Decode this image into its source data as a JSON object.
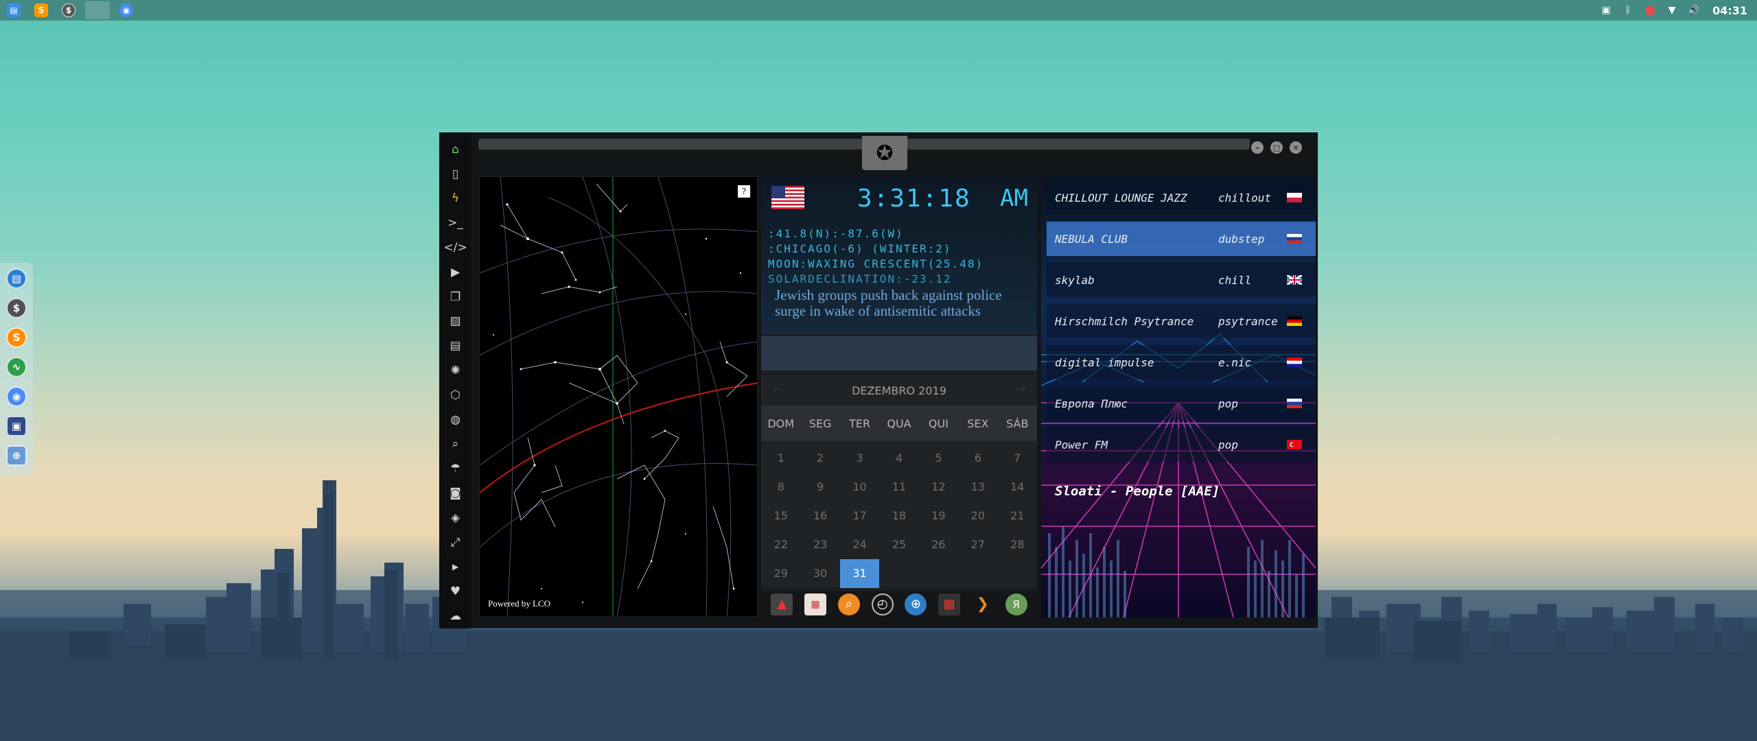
{
  "top_panel": {
    "launchers": [
      {
        "name": "files",
        "icon": "folder-icon",
        "color": "#3a8ee6"
      },
      {
        "name": "sublime",
        "icon": "sublime-icon",
        "color": "#ff9800"
      },
      {
        "name": "terminal-dollar",
        "icon": "dollar-icon",
        "color": "#5a5a5a"
      },
      {
        "name": "window",
        "icon": "window-icon",
        "color": "#6a8ea0"
      },
      {
        "name": "chrome",
        "icon": "chrome-icon",
        "color": "#4a8af4"
      }
    ],
    "clock": "04:31"
  },
  "dock": {
    "items": [
      "file-manager-icon",
      "dollar-icon",
      "sublime-icon",
      "activity-monitor-icon",
      "chrome-icon",
      "screenshot-icon",
      "globe-icon"
    ]
  },
  "window": {
    "sidebar_icons": [
      "home-icon",
      "document-icon",
      "bolt-icon",
      "terminal-icon",
      "code-icon",
      "play-icon",
      "copy-icon",
      "image-icon",
      "news-icon",
      "settings-icon",
      "hexagon-icon",
      "globe-icon",
      "search-icon",
      "umbrella-icon",
      "contact-icon",
      "diamond-icon",
      "fullscreen-icon",
      "youtube-icon",
      "heart-icon",
      "cloud-icon"
    ]
  },
  "starmap": {
    "help": "?",
    "powered_by": "Powered by LCO"
  },
  "clock_widget": {
    "time": "3:31:18",
    "ampm": "AM",
    "coords": ":41.8(N):-87.6(W)",
    "location": ":CHICAGO(-6) (WINTER:2)",
    "moon": "MOON:WAXING CRESCENT(25.48)",
    "solar": "SOLARDECLINATION:-23.12",
    "headline": "Jewish groups push back against police surge in wake of antisemitic attacks"
  },
  "calendar": {
    "month": "DEZEMBRO 2019",
    "prev": "←",
    "next": "→",
    "days": [
      "DOM",
      "SEG",
      "TER",
      "QUA",
      "QUI",
      "SEX",
      "SÁB"
    ],
    "dates": [
      "1",
      "2",
      "3",
      "4",
      "5",
      "6",
      "7",
      "8",
      "9",
      "10",
      "11",
      "12",
      "13",
      "14",
      "15",
      "16",
      "17",
      "18",
      "19",
      "20",
      "21",
      "22",
      "23",
      "24",
      "25",
      "26",
      "27",
      "28",
      "29",
      "30",
      "31"
    ],
    "today": "31"
  },
  "launcher": [
    "red-arrow-icon",
    "calendar-note-icon",
    "search-icon",
    "clock-icon",
    "globe-icon",
    "calendar-icon",
    "play-arrow-icon",
    "yandex-icon"
  ],
  "radio": {
    "stations": [
      {
        "name": "CHILLOUT LOUNGE JAZZ",
        "genre": "chillout",
        "flag": "poland"
      },
      {
        "name": "NEBULA CLUB",
        "genre": "dubstep",
        "flag": "russia"
      },
      {
        "name": "skylab",
        "genre": "chill",
        "flag": "uk"
      },
      {
        "name": "Hirschmilch Psytrance",
        "genre": "psytrance",
        "flag": "germany"
      },
      {
        "name": "digital impulse",
        "genre": "e.nic",
        "flag": "croatia"
      },
      {
        "name": "Европа Плюс",
        "genre": "pop",
        "flag": "russia"
      },
      {
        "name": "Power FM",
        "genre": "pop",
        "flag": "turkey"
      }
    ],
    "selected": 1,
    "now_playing": "Sloati - People [AAE]"
  }
}
